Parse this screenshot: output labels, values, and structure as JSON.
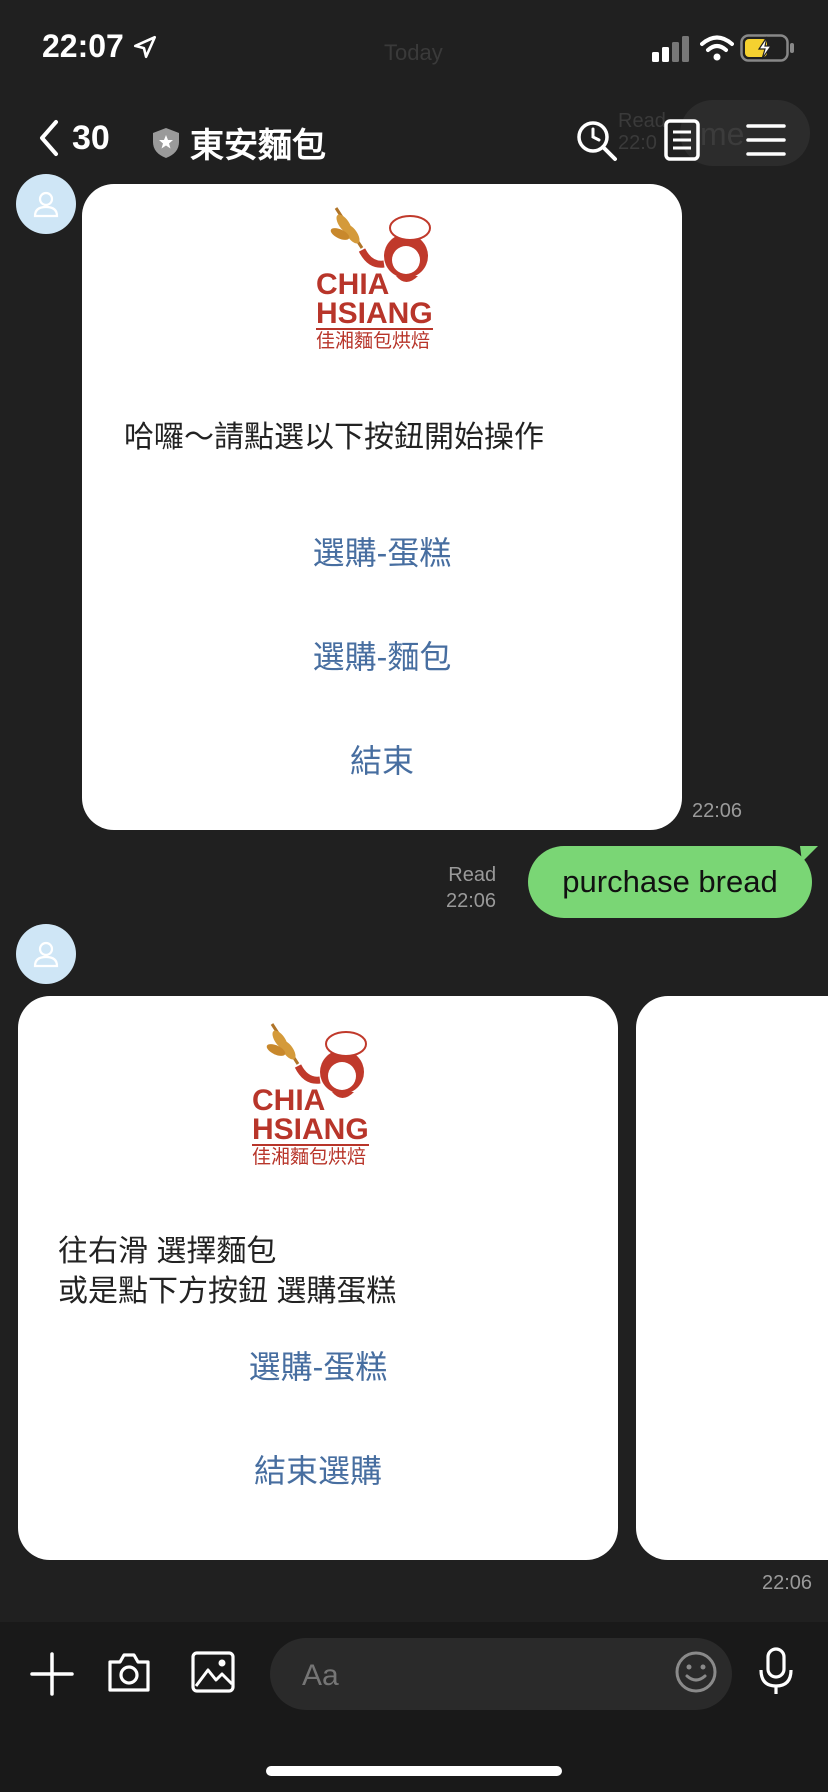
{
  "status": {
    "time": "22:07"
  },
  "ghost": {
    "today": "Today",
    "read": "Read",
    "time": "22:0",
    "text": "me"
  },
  "header": {
    "unread_count": "30",
    "title": "東安麵包"
  },
  "card1": {
    "brand_line1": "CHIA",
    "brand_line2": "HSIANG",
    "brand_sub": "佳湘麵包烘焙",
    "text": "哈囉～請點選以下按鈕開始操作",
    "buttons": [
      "選購-蛋糕",
      "選購-麵包",
      "結束"
    ],
    "time": "22:06"
  },
  "sent": {
    "status": "Read",
    "time": "22:06",
    "text": "purchase bread"
  },
  "card2": {
    "brand_line1": "CHIA",
    "brand_line2": "HSIANG",
    "brand_sub": "佳湘麵包烘焙",
    "text_line1": "往右滑 選擇麵包",
    "text_line2": "或是點下方按鈕 選購蛋糕",
    "buttons": [
      "選購-蛋糕",
      "結束選購"
    ],
    "time": "22:06"
  },
  "input": {
    "placeholder": "Aa"
  },
  "icons": {
    "location": "location-arrow-icon",
    "signal": "signal-icon",
    "wifi": "wifi-icon",
    "battery": "battery-charging-icon",
    "back": "chevron-left-icon",
    "shield": "shield-icon",
    "search": "search-icon",
    "notes": "notes-icon",
    "menu": "menu-icon",
    "avatar": "user-icon",
    "plus": "plus-icon",
    "camera": "camera-icon",
    "image": "image-icon",
    "emoji": "emoji-icon",
    "mic": "microphone-icon"
  },
  "colors": {
    "background": "#202020",
    "sent_bubble": "#7ad675",
    "link": "#476ea0",
    "battery": "#f5d130"
  }
}
